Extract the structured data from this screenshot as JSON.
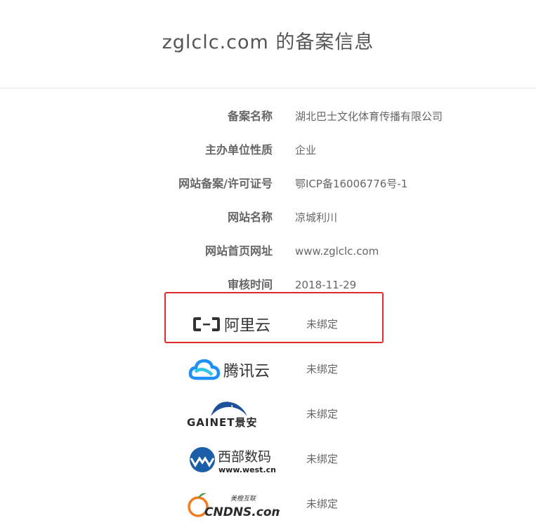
{
  "page": {
    "title": "zglclc.com 的备案信息"
  },
  "record": [
    {
      "label": "备案名称",
      "value": "湖北巴士文化体育传播有限公司"
    },
    {
      "label": "主办单位性质",
      "value": "企业"
    },
    {
      "label": "网站备案/许可证号",
      "value": "鄂ICP备16006776号-1"
    },
    {
      "label": "网站名称",
      "value": "凉城利川"
    },
    {
      "label": "网站首页网址",
      "value": "www.zglclc.com"
    },
    {
      "label": "审核时间",
      "value": "2018-11-29"
    }
  ],
  "providers": [
    {
      "logo_text": "阿里云",
      "icon": "aliyun-logo",
      "status": "未绑定",
      "highlighted": true
    },
    {
      "logo_text": "腾讯云",
      "icon": "tencent-cloud-logo",
      "status": "未绑定"
    },
    {
      "logo_text": "GAINET景安",
      "icon": "gainet-logo",
      "status": "未绑定"
    },
    {
      "logo_text": "西部数码",
      "logo_subtext": "www.west.cn",
      "icon": "west-cn-logo",
      "status": "未绑定"
    },
    {
      "logo_text": "CNDNS.com",
      "logo_subtext": "美橙互联",
      "icon": "cndns-logo",
      "status": "未绑定"
    }
  ],
  "colors": {
    "highlight_border": "#e02b2b",
    "aliyun": "#333333",
    "tencent_blue": "#1d8ff5",
    "tencent_cyan": "#31c6e8",
    "gainet_blue": "#1c4f9c",
    "west_blue": "#1a5ea8",
    "cndns_orange": "#f47a20"
  }
}
